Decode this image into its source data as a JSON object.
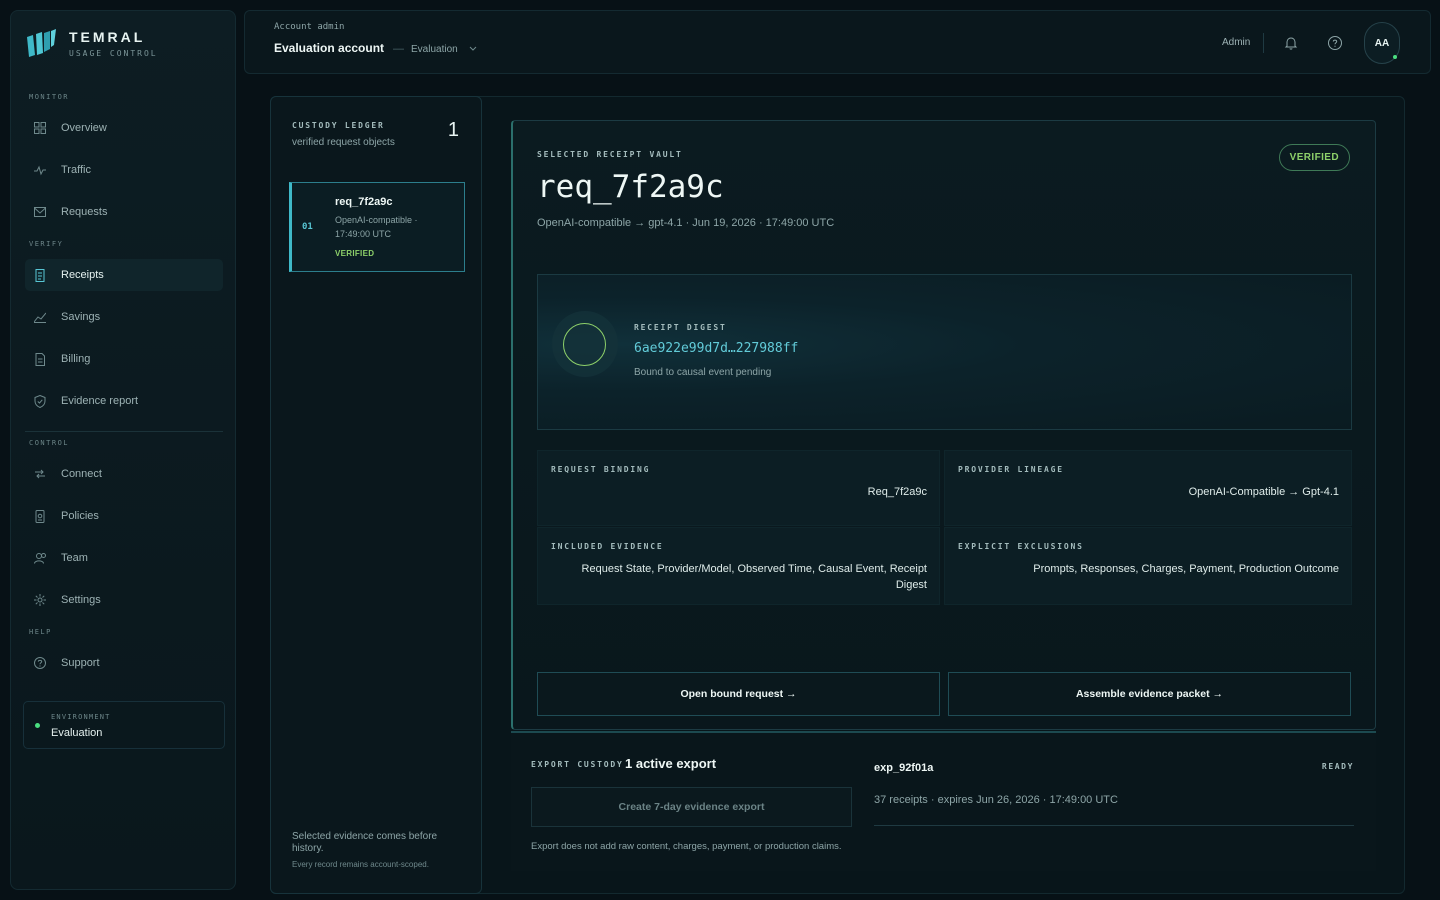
{
  "brand": {
    "name": "TEMRAL",
    "subtitle": "USAGE CONTROL",
    "logo_icon": "temral-logo"
  },
  "sidebar": {
    "sections": {
      "monitor": "MONITOR",
      "verify": "VERIFY",
      "control": "CONTROL",
      "help": "HELP"
    },
    "items": [
      {
        "label": "Overview",
        "icon": "grid-icon"
      },
      {
        "label": "Traffic",
        "icon": "pulse-icon"
      },
      {
        "label": "Requests",
        "icon": "inbox-icon"
      },
      {
        "label": "Receipts",
        "icon": "receipt-icon",
        "active": true
      },
      {
        "label": "Savings",
        "icon": "trend-icon"
      },
      {
        "label": "Billing",
        "icon": "document-icon"
      },
      {
        "label": "Evidence report",
        "icon": "shield-icon"
      },
      {
        "label": "Connect",
        "icon": "connect-icon"
      },
      {
        "label": "Policies",
        "icon": "policy-icon"
      },
      {
        "label": "Team",
        "icon": "users-icon"
      },
      {
        "label": "Settings",
        "icon": "gear-icon"
      },
      {
        "label": "Support",
        "icon": "help-circle-icon"
      }
    ],
    "environment": {
      "label": "ENVIRONMENT",
      "value": "Evaluation",
      "status_color": "#4ade80"
    }
  },
  "topbar": {
    "kicker": "Account admin",
    "title": "Evaluation account",
    "separator": "—",
    "environment": "Evaluation",
    "role": "Admin",
    "avatar_initials": "AA"
  },
  "ledger": {
    "title": "CUSTODY LEDGER",
    "subtitle": "verified request objects",
    "count": "1",
    "items": [
      {
        "index": "01",
        "id": "req_7f2a9c",
        "meta": "OpenAI-compatible · 17:49:00 UTC",
        "status": "VERIFIED"
      }
    ],
    "footer_primary": "Selected evidence comes before history.",
    "footer_secondary": "Every record remains account-scoped."
  },
  "vault": {
    "kicker": "SELECTED RECEIPT VAULT",
    "title": "req_7f2a9c",
    "meta": "OpenAI-compatible → gpt-4.1 · Jun 19, 2026 · 17:49:00 UTC",
    "badge": "VERIFIED",
    "digest": {
      "label": "RECEIPT DIGEST",
      "value": "6ae922e99d7d…227988ff",
      "note": "Bound to causal event pending"
    },
    "fields": {
      "request_binding": {
        "label": "REQUEST BINDING",
        "value": "Req_7f2a9c"
      },
      "provider_lineage": {
        "label": "PROVIDER LINEAGE",
        "value": "OpenAI-Compatible → Gpt-4.1"
      },
      "included_evidence": {
        "label": "INCLUDED EVIDENCE",
        "value": "Request State, Provider/Model, Observed Time, Causal Event, Receipt Digest"
      },
      "explicit_exclusions": {
        "label": "EXPLICIT EXCLUSIONS",
        "value": "Prompts, Responses, Charges, Payment, Production Outcome"
      }
    },
    "actions": {
      "open_request": "Open bound request →",
      "assemble_packet": "Assemble evidence packet →"
    }
  },
  "export": {
    "kicker": "EXPORT CUSTODY",
    "active_count": "1 active export",
    "create_label": "Create 7-day evidence export",
    "note": "Export does not add raw content, charges, payment, or production claims.",
    "item": {
      "id": "exp_92f01a",
      "status": "READY",
      "detail": "37 receipts · expires Jun 26, 2026 · 17:49:00 UTC"
    }
  },
  "colors": {
    "accent_cyan": "#3fb9c8",
    "verified_green": "#8ed16a",
    "background": "#071116"
  }
}
